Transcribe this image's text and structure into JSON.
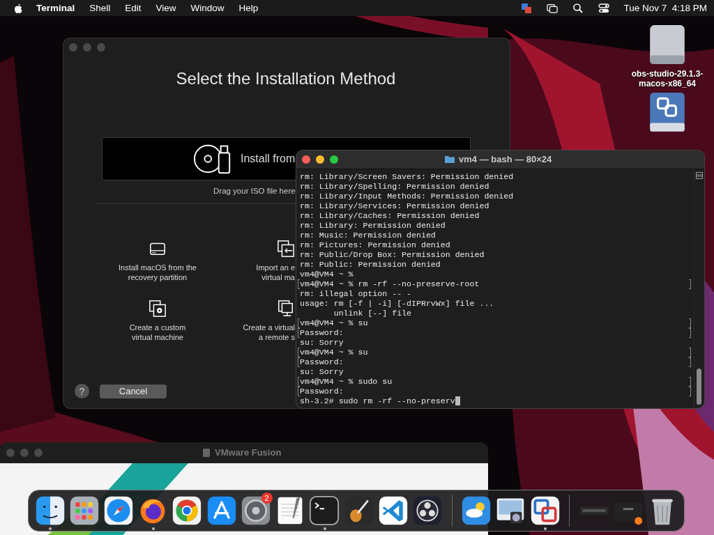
{
  "menu_bar": {
    "app_name": "Terminal",
    "menus": [
      "Shell",
      "Edit",
      "View",
      "Window",
      "Help"
    ],
    "clock": "Tue Nov 7  4:18 PM"
  },
  "desktop_icons": [
    {
      "kind": "drive",
      "label": "obs-studio-29.1.3-macos-x86_64"
    },
    {
      "kind": "vm-drive"
    }
  ],
  "installer": {
    "title": "Select the Installation Method",
    "drop_button": "Install from",
    "drop_hint": "Drag your ISO file here",
    "options": [
      {
        "kind": "disk",
        "lines": [
          "Install macOS from the",
          "recovery partition"
        ]
      },
      {
        "kind": "import",
        "lines": [
          "Import an e",
          "virtual ma"
        ]
      },
      {
        "kind": "custom",
        "lines": [
          "Create a custom",
          "virtual machine"
        ]
      },
      {
        "kind": "remote",
        "lines": [
          "Create a virtual",
          "a remote s"
        ]
      }
    ],
    "help": "?",
    "cancel": "Cancel"
  },
  "terminal": {
    "title": "vm4 — bash — 80×24",
    "lines": [
      {
        "text": "rm: Library/Screen Savers: Permission denied",
        "marked": false
      },
      {
        "text": "rm: Library/Spelling: Permission denied",
        "marked": false
      },
      {
        "text": "rm: Library/Input Methods: Permission denied",
        "marked": false
      },
      {
        "text": "rm: Library/Services: Permission denied",
        "marked": false
      },
      {
        "text": "rm: Library/Caches: Permission denied",
        "marked": false
      },
      {
        "text": "rm: Library: Permission denied",
        "marked": false
      },
      {
        "text": "rm: Music: Permission denied",
        "marked": false
      },
      {
        "text": "rm: Pictures: Permission denied",
        "marked": false
      },
      {
        "text": "rm: Public/Drop Box: Permission denied",
        "marked": false
      },
      {
        "text": "rm: Public: Permission denied",
        "marked": false
      },
      {
        "text": "vm4@VM4 ~ %",
        "marked": false
      },
      {
        "text": "vm4@VM4 ~ % rm -rf --no-preserve-root",
        "marked": true
      },
      {
        "text": "rm: illegal option -- -",
        "marked": false
      },
      {
        "text": "usage: rm [-f | -i] [-dIPRrvWx] file ...",
        "marked": false
      },
      {
        "text": "       unlink [--] file",
        "marked": false
      },
      {
        "text": "vm4@VM4 ~ % su",
        "marked": true
      },
      {
        "text": "Password:",
        "marked": true
      },
      {
        "text": "su: Sorry",
        "marked": false
      },
      {
        "text": "vm4@VM4 ~ % su",
        "marked": true
      },
      {
        "text": "Password:",
        "marked": true
      },
      {
        "text": "su: Sorry",
        "marked": false
      },
      {
        "text": "vm4@VM4 ~ % sudo su",
        "marked": true
      },
      {
        "text": "Password:",
        "marked": true
      },
      {
        "text": "sh-3.2# sudo rm -rf --no-preserv",
        "marked": false
      }
    ]
  },
  "vmware_window": {
    "title": "VMware Fusion"
  },
  "dock": {
    "items": [
      {
        "kind": "finder",
        "running": true
      },
      {
        "kind": "launchpad",
        "running": false
      },
      {
        "kind": "safari",
        "running": false
      },
      {
        "kind": "firefox",
        "running": true
      },
      {
        "kind": "chrome",
        "running": false
      },
      {
        "kind": "appstore",
        "running": false
      },
      {
        "kind": "settings",
        "running": false,
        "badge": "2"
      },
      {
        "kind": "textedit",
        "running": false
      },
      {
        "kind": "terminal",
        "running": true
      },
      {
        "kind": "guitar",
        "running": false
      },
      {
        "kind": "vscode",
        "running": false
      },
      {
        "kind": "obs",
        "running": false
      },
      {
        "kind": "separator"
      },
      {
        "kind": "weather",
        "running": false
      },
      {
        "kind": "preview",
        "running": false
      },
      {
        "kind": "vmware",
        "running": true
      },
      {
        "kind": "separator"
      },
      {
        "kind": "minimized",
        "running": false
      },
      {
        "kind": "minimized-firefox",
        "running": false
      },
      {
        "kind": "trash",
        "running": false
      }
    ]
  }
}
